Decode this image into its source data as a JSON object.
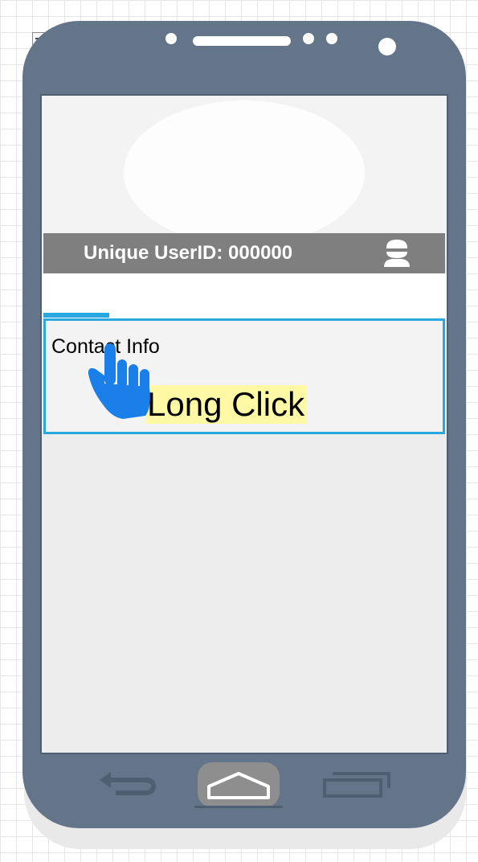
{
  "header": {
    "title": "Unique UserID: 000000",
    "icon": "user-icon"
  },
  "contact": {
    "label": "Contact Info"
  },
  "annotation": {
    "label": "Long Click",
    "icon": "pointing-hand-icon"
  },
  "nav": {
    "back_icon": "back-arrow-icon",
    "home_icon": "home-icon",
    "recent_icon": "recent-apps-icon"
  },
  "colors": {
    "phone_body": "#64758a",
    "header_bar": "#7f7f7f",
    "accent": "#29a8e0",
    "hand": "#1a7fe8",
    "highlight": "#fff9a6"
  }
}
